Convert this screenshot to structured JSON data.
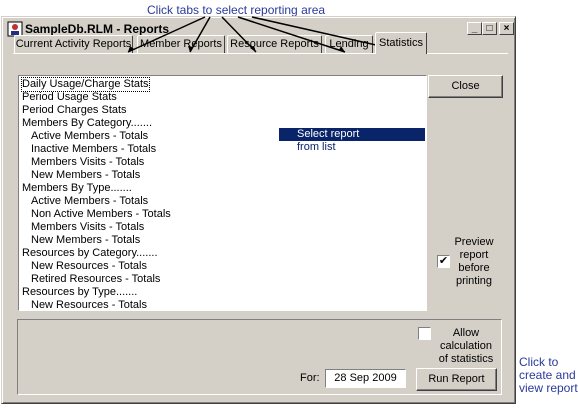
{
  "annotations": {
    "top": "Click tabs to select reporting area",
    "side": [
      "Click to",
      "create and",
      "view report"
    ]
  },
  "window": {
    "title": "SampleDb.RLM - Reports",
    "controls": [
      "_",
      "□",
      "×"
    ]
  },
  "tabs": [
    {
      "label": "Current Activity Reports",
      "active": false
    },
    {
      "label": "Member Reports",
      "active": false
    },
    {
      "label": "Resource Reports",
      "active": false
    },
    {
      "label": "Lending",
      "active": false
    },
    {
      "label": "Statistics",
      "active": true
    }
  ],
  "report_list": [
    "Daily Usage/Charge Stats",
    "Period Usage Stats",
    "Period Charges Stats",
    "Members By Category.......",
    "  Active Members - Totals",
    "  Inactive Members - Totals",
    "  Members Visits - Totals",
    "  New Members - Totals",
    "Members By Type.......",
    "  Active Members - Totals",
    "  Non Active Members - Totals",
    "  Members Visits - Totals",
    "  New Members - Totals",
    "Resources by Category.......",
    "  New Resources - Totals",
    "  Retired Resources - Totals",
    "Resources by Type.......",
    "  New Resources - Totals"
  ],
  "hint": [
    "Select report",
    "from list"
  ],
  "close_label": "Close",
  "preview": {
    "lines": [
      "Preview",
      "report",
      "before",
      "printing"
    ],
    "checked": true,
    "mark": "✔"
  },
  "allow_calc": {
    "lines": [
      "Allow",
      "calculation",
      "of statistics"
    ],
    "checked": false
  },
  "for_label": "For:",
  "date_value": "28 Sep 2009",
  "run_label": "Run Report",
  "colors": {
    "annotation": "#2a3a9a",
    "selection": "#0a246a",
    "face": "#d4d0c8"
  }
}
